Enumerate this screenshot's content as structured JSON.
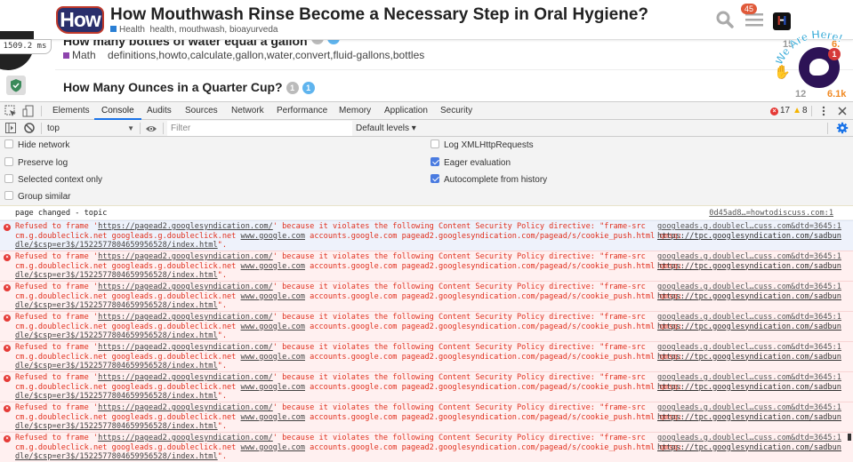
{
  "website": {
    "logo_text": "How",
    "title": "How Mouthwash Rinse Become a Necessary Step in Oral Hygiene?",
    "category": "Health",
    "category_color": "#2a7fd4",
    "tags": "health, mouthwash, bioayurveda",
    "menu_badge": "45",
    "h_badge": "H",
    "list_items": [
      {
        "title": "How many bottles of water equal a gallon",
        "category": "Math",
        "category_color": "#8e44ad",
        "tags": "definitions,howto,calculate,gallon,water,convert,fluid-gallons,bottles"
      },
      {
        "title": "How Many Ounces in a Quarter Cup?",
        "answers": "1",
        "votes": "1"
      }
    ],
    "stats_top": [
      "15",
      "6."
    ],
    "stats_bottom": [
      "12",
      "6.1k"
    ],
    "perf_badge": "1509.2 ms",
    "chat_badge": "1",
    "we_are_here": "We Are Here!"
  },
  "devtools": {
    "tabs": [
      "Elements",
      "Console",
      "Audits",
      "Sources",
      "Network",
      "Performance",
      "Memory",
      "Application",
      "Security"
    ],
    "active_tab": "Console",
    "error_count": "17",
    "warning_count": "8",
    "context": "top",
    "filter_placeholder": "Filter",
    "levels_label": "Default levels ▾",
    "settings_left": [
      {
        "label": "Hide network",
        "checked": false
      },
      {
        "label": "Preserve log",
        "checked": false
      },
      {
        "label": "Selected context only",
        "checked": false
      },
      {
        "label": "Group similar",
        "checked": false
      }
    ],
    "settings_right": [
      {
        "label": "Log XMLHttpRequests",
        "checked": false
      },
      {
        "label": "Eager evaluation",
        "checked": true
      },
      {
        "label": "Autocomplete from history",
        "checked": true
      }
    ],
    "log": {
      "text": "page changed - topic",
      "source": "0d45ad8…=howtodiscuss.com:1"
    },
    "error_message": {
      "prefix": "Refused to frame '",
      "url": "https://pagead2.googlesyndication.com/",
      "mid": "' because it violates the following Content Security Policy directive: \"frame-src",
      "line2a": "cm.g.doubleclick.net googleads.g.doubleclick.net ",
      "line2_link": "www.google.com",
      "line2b": " accounts.google.com pagead2.googlesyndication.com/pagead/s/cookie_push.html gmsg: ",
      "line2_link2": "https://tpc.googlesyndication.com/sadbun",
      "line3_link": "dle/$csp=er3$/1522577804659956528/index.html",
      "line3_end": "\".",
      "source": "googleads.g.doublecl…cuss.com&dtd=3645:1"
    },
    "error_rows": 8
  }
}
